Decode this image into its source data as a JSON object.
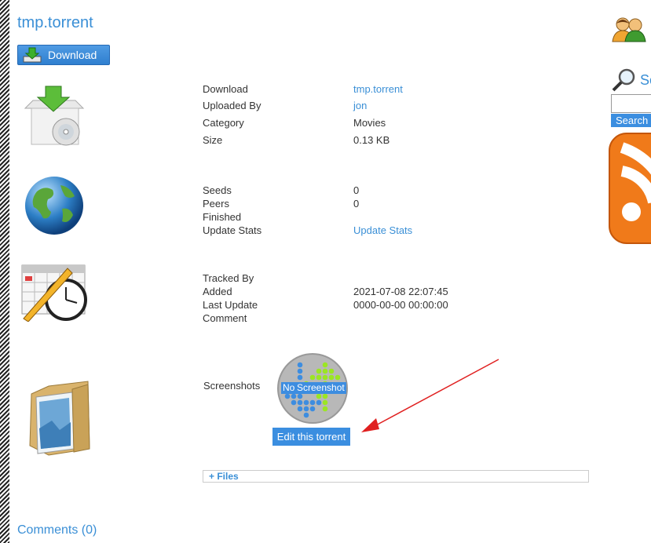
{
  "page_title": "tmp.torrent",
  "download_button": "Download",
  "details": {
    "download_label": "Download",
    "download_value": "tmp.torrent",
    "uploaded_by_label": "Uploaded By",
    "uploaded_by_value": "jon",
    "category_label": "Category",
    "category_value": "Movies",
    "size_label": "Size",
    "size_value": "0.13 KB"
  },
  "stats": {
    "seeds_label": "Seeds",
    "seeds_value": "0",
    "peers_label": "Peers",
    "peers_value": "0",
    "finished_label": "Finished",
    "update_label": "Update Stats",
    "update_value": "Update Stats"
  },
  "tracking": {
    "tracked_by_label": "Tracked By",
    "added_label": "Added",
    "added_value": "2021-07-08 22:07:45",
    "last_update_label": "Last Update",
    "last_update_value": "0000-00-00 00:00:00",
    "comment_label": "Comment"
  },
  "screenshots": {
    "label": "Screenshots",
    "placeholder_no": "No",
    "placeholder_screenshot": "Screenshot",
    "edit_button": "Edit this torrent"
  },
  "files_toggle": "+ Files",
  "comments_link": "Comments (0)",
  "sidebar": {
    "search_heading": "Se",
    "search_button": "Search"
  },
  "colors": {
    "link": "#3a8fd6",
    "button": "#3b8ee0",
    "arrow": "#e02020",
    "rss": "#f07a1a"
  },
  "icons": [
    "download-arrow-icon",
    "package-disc-icon",
    "globe-icon",
    "calendar-clock-icon",
    "folder-picture-icon",
    "users-icon",
    "magnifier-icon",
    "rss-icon"
  ]
}
